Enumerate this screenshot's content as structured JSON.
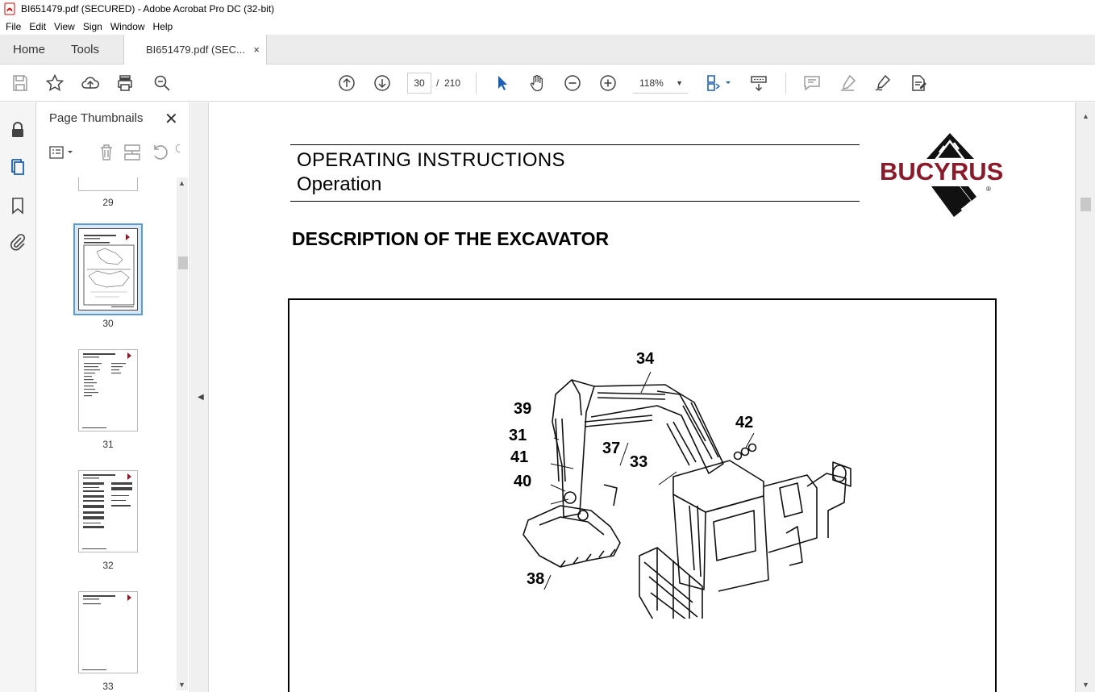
{
  "window": {
    "title": "BI651479.pdf (SECURED) - Adobe Acrobat Pro DC (32-bit)"
  },
  "menu": [
    "File",
    "Edit",
    "View",
    "Sign",
    "Window",
    "Help"
  ],
  "tabs": {
    "home": "Home",
    "tools": "Tools",
    "document": "BI651479.pdf (SEC...",
    "close": "×"
  },
  "toolbar": {
    "current_page": "30",
    "page_separator": "/",
    "total_pages": "210",
    "zoom": "118%",
    "icons": [
      "save-icon",
      "star-icon",
      "upload-icon",
      "print-icon",
      "zoom-search-icon",
      "page-up-icon",
      "page-down-icon",
      "select-cursor-icon",
      "hand-icon",
      "zoom-out-icon",
      "zoom-in-icon",
      "page-fit-icon",
      "scroll-mode-icon",
      "comment-icon",
      "highlight-icon",
      "sign-icon",
      "edit-pdf-icon"
    ]
  },
  "left_rail": {
    "icons": [
      "lock-icon",
      "pages-icon",
      "bookmark-icon",
      "attachment-icon"
    ]
  },
  "thumbnails_panel": {
    "title": "Page Thumbnails",
    "close": "✕",
    "pages": [
      {
        "label": "29"
      },
      {
        "label": "30",
        "selected": true
      },
      {
        "label": "31"
      },
      {
        "label": "32"
      },
      {
        "label": "33"
      }
    ]
  },
  "document": {
    "header_title": "OPERATING INSTRUCTIONS",
    "header_subtitle": "Operation",
    "logo_text": "BUCYRUS",
    "logo_mark": "®",
    "heading": "DESCRIPTION OF THE EXCAVATOR",
    "callouts": [
      "34",
      "39",
      "31",
      "41",
      "40",
      "37",
      "33",
      "42",
      "38"
    ]
  },
  "colors": {
    "accent_blue": "#1a5fb4",
    "logo_red": "#8b1a2b",
    "selection_border": "#5b9bd5"
  }
}
